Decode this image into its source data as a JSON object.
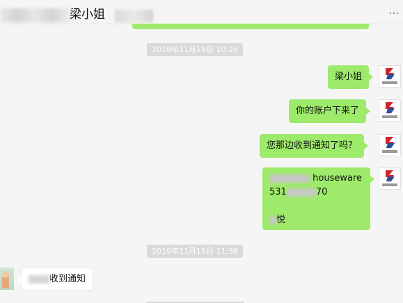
{
  "window": {
    "title_name": "梁小姐",
    "more_icon": "…"
  },
  "chat": {
    "timestamps": [
      "2019年11月19日 10:26",
      "2019年11月19日 11:38"
    ],
    "out_messages": [
      {
        "text": "梁小姐"
      },
      {
        "text": "你的账户下来了"
      },
      {
        "text": "您那边收到通知了吗？"
      }
    ],
    "card": {
      "line1": "houseware",
      "line2_prefix": "531",
      "line2_suffix": "70",
      "line3": "悦"
    },
    "in_message": {
      "text": "收到通知"
    },
    "avatar_brand": "新晨国际"
  },
  "colors": {
    "bubble_out": "#9eea6a",
    "bubble_in": "#ffffff",
    "brand_red": "#d2232a",
    "brand_blue": "#2a4f9c"
  }
}
